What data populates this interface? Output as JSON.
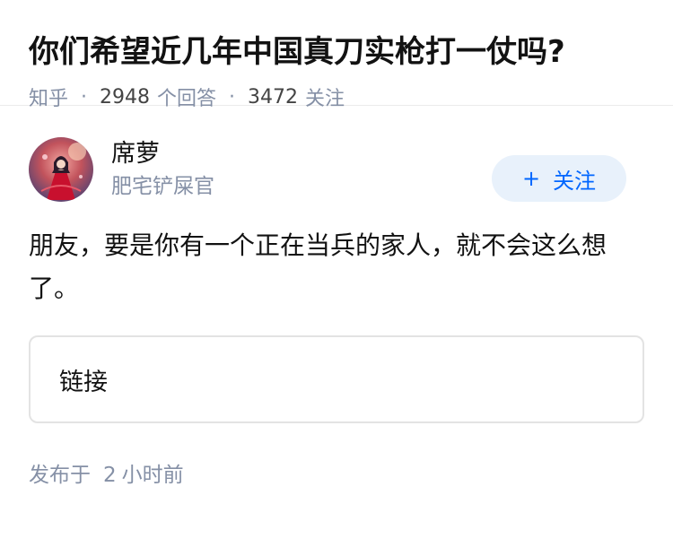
{
  "question": {
    "title": "你们希望近几年中国真刀实枪打一仗吗?",
    "source": "知乎",
    "answer_count": "2948",
    "answer_label": "个回答",
    "follower_count": "3472",
    "follower_label": "关注"
  },
  "answer": {
    "author": {
      "name": "席萝",
      "bio": "肥宅铲屎官",
      "avatar_icon": "anime-avatar"
    },
    "follow_button": {
      "plus": "+",
      "label": "关注"
    },
    "content": "朋友，要是你有一个正在当兵的家人，就不会这么想了。",
    "link_card": {
      "label": "链接"
    },
    "publish": {
      "prefix": "发布于",
      "value": "2",
      "unit": "小时前"
    }
  },
  "colors": {
    "accent": "#0066ff",
    "follow_bg": "#e8f1fb",
    "meta_gray": "#8590a6"
  }
}
